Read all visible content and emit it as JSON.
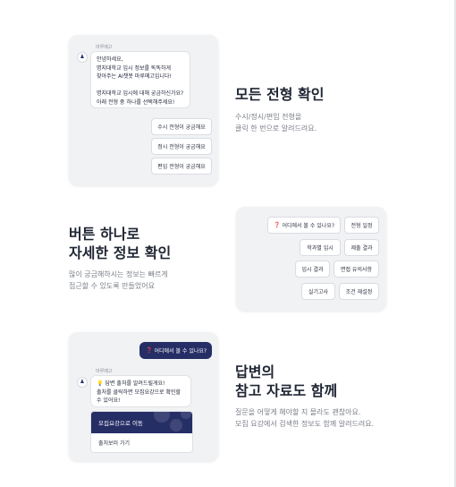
{
  "section1": {
    "bot_name": "마루메고",
    "greeting_lines": [
      "안녕하세요,",
      "명지대학교 입시 정보를 똑똑하게",
      "찾아주는 AI챗봇 마루메고입니다!",
      "",
      "명지대학교 입시에 대해 궁금하신가요?",
      "아래 전형 중 하나를 선택해주세요!"
    ],
    "options": [
      "수시 전형이 궁금해요",
      "정시 전형이 궁금해요",
      "편입 전형이 궁금해요"
    ],
    "title": "모든 전형 확인",
    "desc_lines": [
      "수시/정시/편입 전형을",
      "클릭 한 번으로 알려드려요."
    ]
  },
  "section2": {
    "title_lines": [
      "버튼 하나로",
      "자세한 정보 확인"
    ],
    "desc_lines": [
      "많이 궁금해하시는 정보는 빠르게",
      "접근할 수 있도록 만들었어요"
    ],
    "buttons": [
      [
        "어디에서 볼 수 있나요?",
        "전형 일정"
      ],
      [
        "학과별 입시",
        "제출 결과"
      ],
      [
        "입시 결과",
        "면접 유의사항"
      ],
      [
        "실기고사",
        "조건 재설정"
      ]
    ]
  },
  "section3": {
    "user_message": "어디에서 볼 수 있나요?",
    "bot_name": "마루메고",
    "answer_lines": [
      "답변 출처를 알려드릴게요!",
      "출처를 클릭하면 모집요강으로 확인할",
      "수 있어요!"
    ],
    "link_primary": "모집요강으로 이동",
    "link_secondary": "출처보러 가기",
    "title_lines": [
      "답변의",
      "참고 자료도 함께"
    ],
    "desc_lines": [
      "질문을 어떻게 해야할 지 몰라도 괜찮아요.",
      "모집 요강에서 검색한 정보도 함께 알려드려요."
    ]
  },
  "colors": {
    "navy": "#262e66",
    "card_bg": "#f1f2f4",
    "heading": "#1f2533",
    "muted": "#7a7f88"
  },
  "icons": {
    "avatar": "lion-mascot-icon",
    "question": "question-mark-emoji-icon",
    "lightbulb": "lightbulb-emoji-icon"
  }
}
